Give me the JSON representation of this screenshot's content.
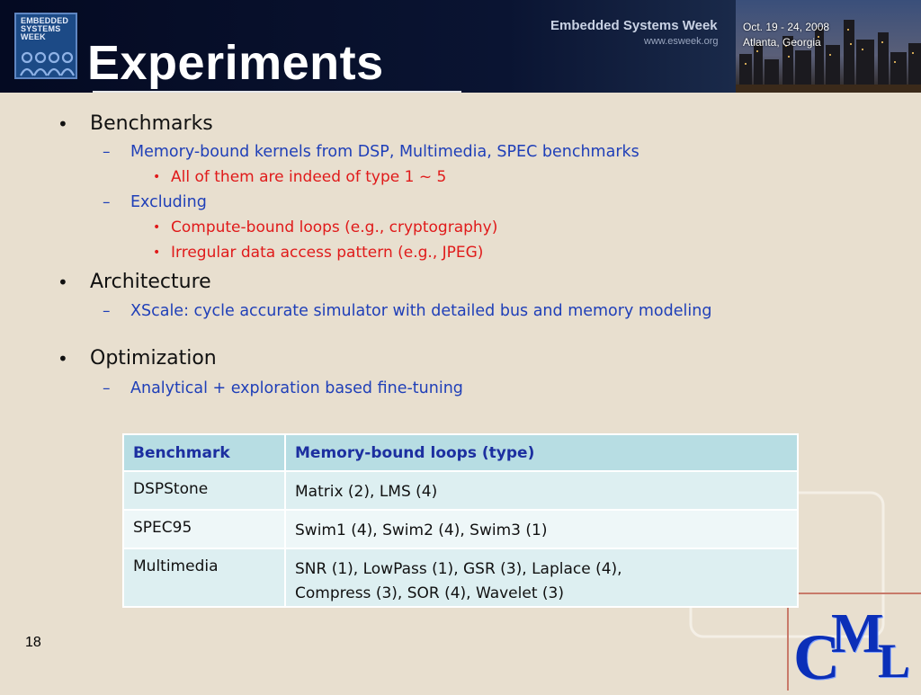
{
  "header": {
    "logo_lines": [
      "EMBEDDED",
      "SYSTEMS",
      "WEEK"
    ],
    "title": "Experiments",
    "conference_name": "Embedded Systems Week",
    "conference_url": "www.esweek.org",
    "conference_date": "Oct. 19 - 24, 2008",
    "conference_place": "Atlanta, Georgia"
  },
  "bullets": {
    "benchmarks": {
      "label": "Benchmarks",
      "sub1": "Memory-bound kernels from DSP, Multimedia, SPEC benchmarks",
      "sub1_note": "All of them are indeed of type 1 ~ 5",
      "sub2": "Excluding",
      "sub2_items": [
        "Compute-bound loops (e.g., cryptography)",
        "Irregular data access pattern (e.g., JPEG)"
      ]
    },
    "architecture": {
      "label": "Architecture",
      "sub1": "XScale: cycle accurate simulator with detailed bus and memory modeling"
    },
    "optimization": {
      "label": "Optimization",
      "sub1": "Analytical + exploration based fine-tuning"
    },
    "bullet_glyph": "•",
    "dash_glyph": "–"
  },
  "table": {
    "headers": [
      "Benchmark",
      "Memory-bound loops (type)"
    ],
    "rows": [
      {
        "benchmark": "DSPStone",
        "loops": [
          "Matrix (2), LMS (4)"
        ]
      },
      {
        "benchmark": "SPEC95",
        "loops": [
          "Swim1 (4), Swim2 (4), Swim3 (1)"
        ]
      },
      {
        "benchmark": "Multimedia",
        "loops": [
          "SNR (1), LowPass (1), GSR (3), Laplace (4),",
          "Compress (3), SOR (4), Wavelet (3)"
        ]
      }
    ]
  },
  "footer": {
    "page_number": "18",
    "logo_letters": [
      "C",
      "M",
      "L"
    ]
  },
  "colors": {
    "background": "#e8dfcf",
    "header": "#0a1432",
    "level2_text": "#1f3fb8",
    "level3_text": "#e01a1a",
    "table_header": "#b7dde3",
    "table_row": "#ddeff1",
    "logo_blue": "#0b2fb8"
  }
}
